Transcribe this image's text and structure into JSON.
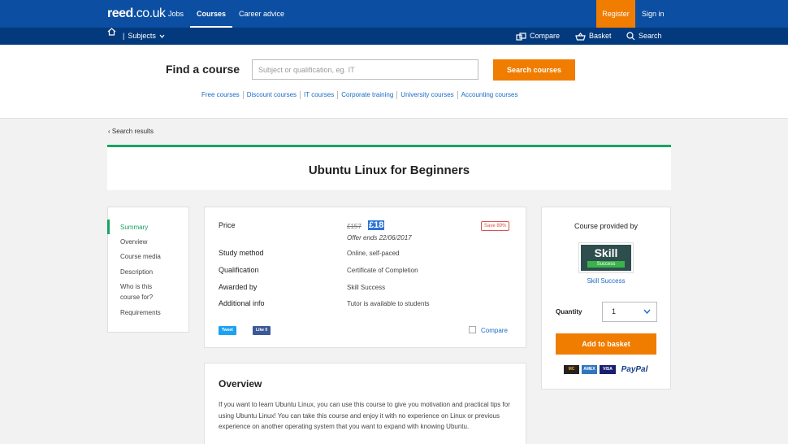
{
  "header": {
    "logo": "reed",
    "logo_suffix": ".co.uk",
    "nav": [
      "Jobs",
      "Courses",
      "Career advice"
    ],
    "active_nav": "Courses",
    "register": "Register",
    "sign_in": "Sign in"
  },
  "subbar": {
    "subjects": "Subjects",
    "compare": "Compare",
    "basket": "Basket",
    "search": "Search"
  },
  "search": {
    "label": "Find a course",
    "placeholder": "Subject or qualification, eg. IT",
    "button": "Search courses",
    "quick_links": [
      "Free courses",
      "Discount courses",
      "IT courses",
      "Corporate training",
      "University courses",
      "Accounting courses"
    ]
  },
  "breadcrumb": "Search results",
  "course": {
    "title": "Ubuntu Linux for Beginners"
  },
  "sidenav": {
    "items": [
      "Summary",
      "Overview",
      "Course media",
      "Description",
      "Who is this course for?",
      "Requirements"
    ],
    "active": "Summary"
  },
  "details": {
    "price_label": "Price",
    "old_price": "£157",
    "new_price": "£18",
    "offer": "Offer ends 22/06/2017",
    "save_badge": "Save 89%",
    "rows": [
      {
        "label": "Study method",
        "value": "Online, self-paced"
      },
      {
        "label": "Qualification",
        "value": "Certificate of Completion"
      },
      {
        "label": "Awarded by",
        "value": "Skill Success"
      },
      {
        "label": "Additional info",
        "value": "Tutor is available to students"
      }
    ],
    "tweet": "Tweet",
    "like": "Like 0",
    "compare": "Compare"
  },
  "provider": {
    "heading": "Course provided by",
    "logo_main": "Skill",
    "logo_sub": "Success",
    "name": "Skill Success",
    "quantity_label": "Quantity",
    "quantity_value": "1",
    "add_button": "Add to basket",
    "payments": [
      "MC",
      "AMEX",
      "VISA",
      "PayPal"
    ]
  },
  "overview": {
    "heading": "Overview",
    "text": "If you want to learn Ubuntu Linux, you can use this course to give you motivation and practical tips for using Ubuntu Linux! You can take this course and enjoy it with no experience on Linux or previous experience on another operating system that you want to expand with knowing Ubuntu."
  },
  "colors": {
    "brand_blue": "#0b4ea2",
    "subbar_blue": "#033a7d",
    "orange": "#f07c00",
    "green": "#17a462",
    "link": "#1a6bc4"
  }
}
